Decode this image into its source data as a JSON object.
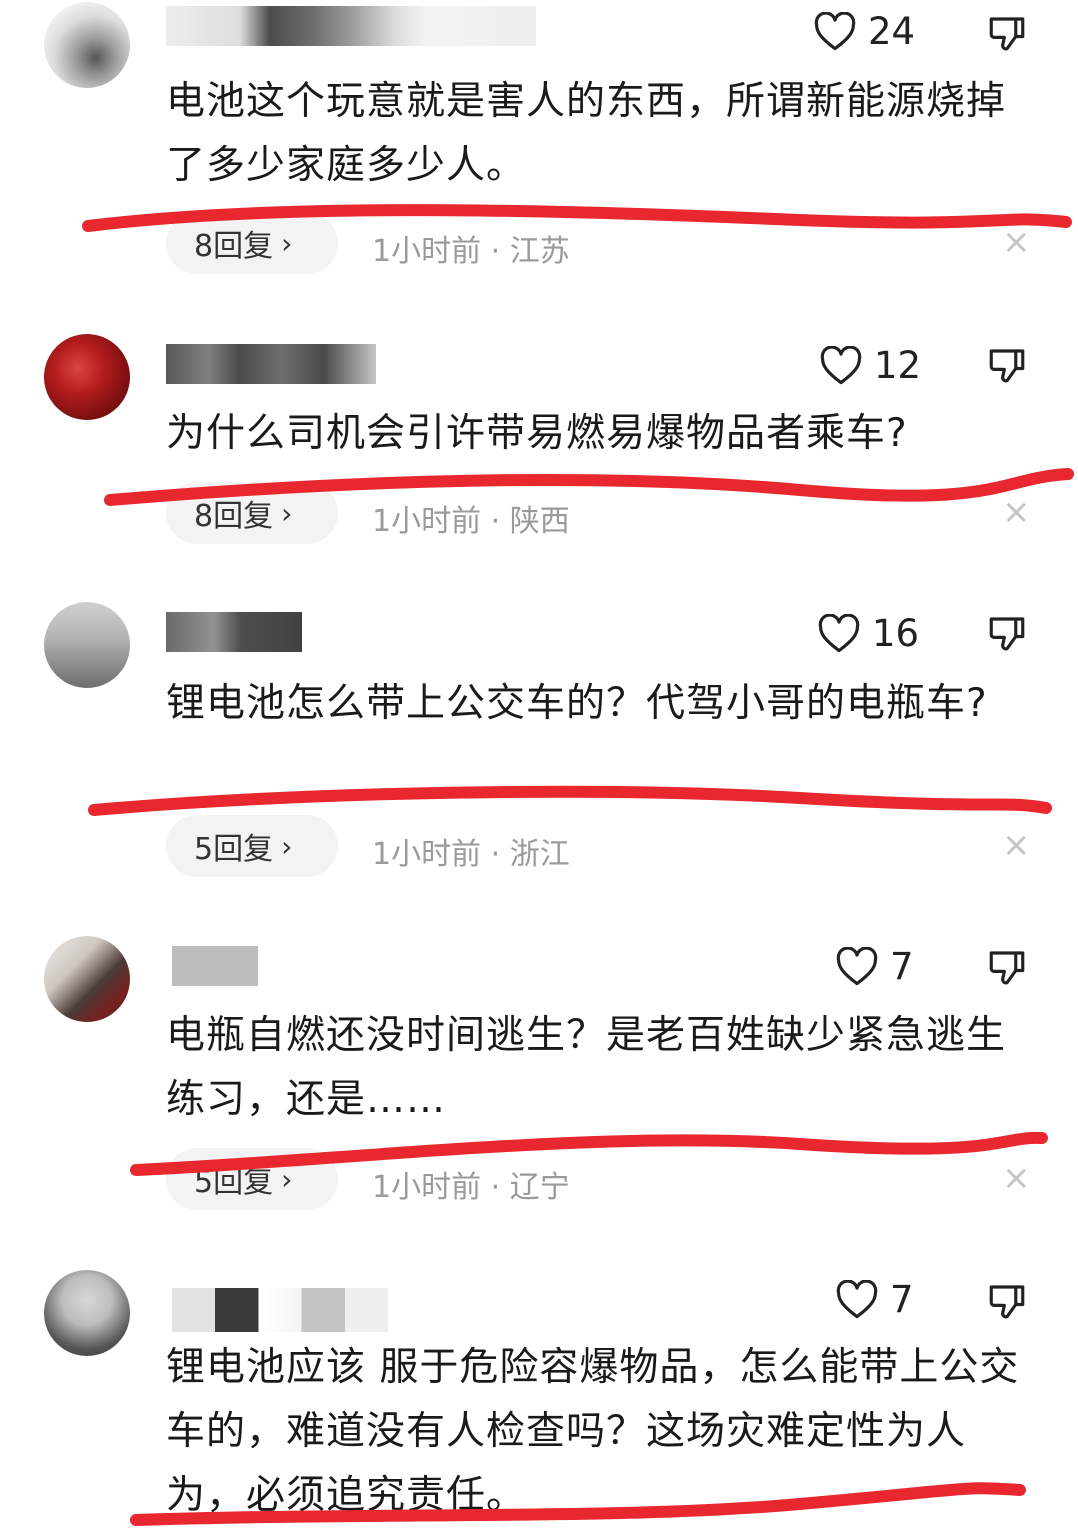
{
  "comments": [
    {
      "likes": "24",
      "text": "电池这个玩意就是害人的东西，所谓新能源烧掉了多少家庭多少人。",
      "replies": "8回复",
      "meta": "1小时前 · 江苏"
    },
    {
      "likes": "12",
      "text": "为什么司机会引许带易燃易爆物品者乘车?",
      "replies": "8回复",
      "meta": "1小时前 · 陕西"
    },
    {
      "likes": "16",
      "text": "锂电池怎么带上公交车的？代驾小哥的电瓶车?",
      "replies": "5回复",
      "meta": "1小时前 · 浙江"
    },
    {
      "likes": "7",
      "text": "电瓶自燃还没时间逃生？是老百姓缺少紧急逃生练习，还是……",
      "replies": "5回复",
      "meta": "1小时前 · 辽宁"
    },
    {
      "likes": "7",
      "text": "锂电池应该 服于危险容爆物品，怎么能带上公交车的，难道没有人检查吗？这场灾难定性为人为，必须追究责任。"
    }
  ],
  "icons": {
    "like": "heart-outline-icon",
    "dislike": "thumbs-down-icon",
    "close": "close-icon",
    "chevron": "chevron-right-icon"
  },
  "ui": {
    "chevron": "›",
    "close": "×"
  },
  "colors": {
    "highlight": "#e8282e",
    "meta": "#9a9a9a",
    "pill": "#f3f3f3"
  }
}
